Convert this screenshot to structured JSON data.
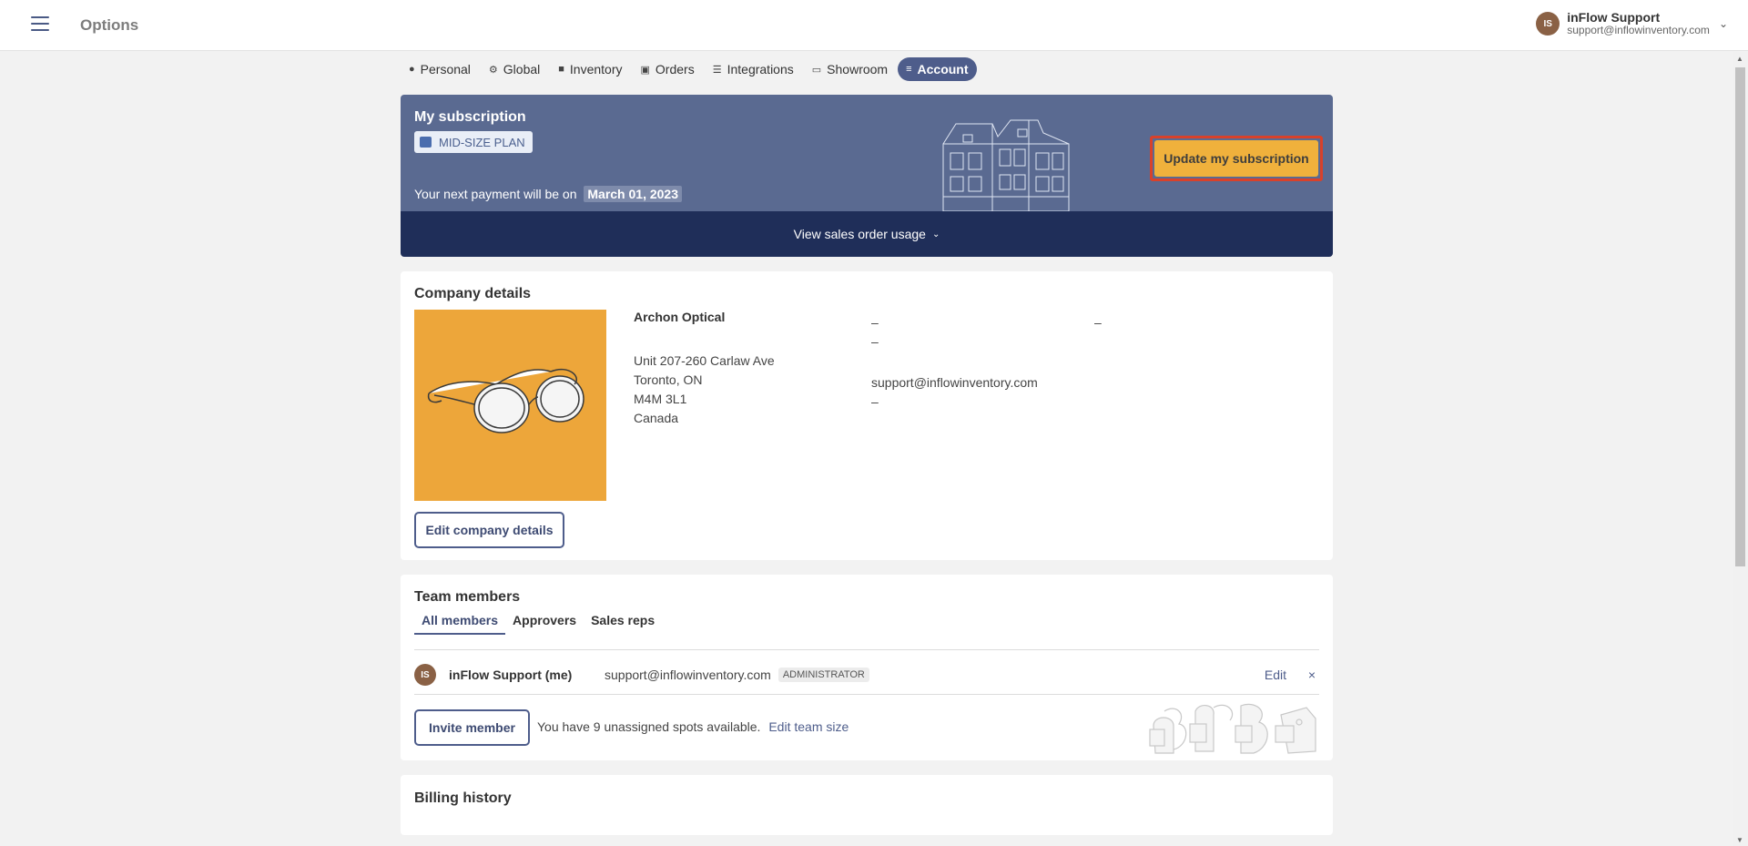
{
  "header": {
    "title": "Options",
    "user_initials": "IS",
    "user_name": "inFlow Support",
    "user_email": "support@inflowinventory.com"
  },
  "tabs": [
    {
      "label": "Personal",
      "icon": "person-icon"
    },
    {
      "label": "Global",
      "icon": "gear-icon"
    },
    {
      "label": "Inventory",
      "icon": "box-icon"
    },
    {
      "label": "Orders",
      "icon": "bag-icon"
    },
    {
      "label": "Integrations",
      "icon": "list-icon"
    },
    {
      "label": "Showroom",
      "icon": "laptop-icon"
    },
    {
      "label": "Account",
      "icon": "sliders-icon",
      "active": true
    }
  ],
  "subscription": {
    "title": "My subscription",
    "plan": "MID-SIZE PLAN",
    "payment_prefix": "Your next payment will be on",
    "payment_date": "March 01, 2023",
    "update_button": "Update my subscription",
    "usage_toggle": "View sales order usage"
  },
  "company": {
    "title": "Company details",
    "name": "Archon Optical",
    "address_line1": "Unit 207-260 Carlaw Ave",
    "address_line2": "Toronto, ON",
    "postal": "M4M 3L1",
    "country": "Canada",
    "dash": "–",
    "email": "support@inflowinventory.com",
    "edit_button": "Edit company details"
  },
  "team": {
    "title": "Team members",
    "tabs": [
      "All members",
      "Approvers",
      "Sales reps"
    ],
    "member": {
      "initials": "IS",
      "name": "inFlow Support (me)",
      "email": "support@inflowinventory.com",
      "role": "ADMINISTRATOR",
      "edit": "Edit",
      "remove": "×"
    },
    "invite_button": "Invite member",
    "spots_text": "You have 9 unassigned spots available.",
    "edit_team_size": "Edit team size"
  },
  "billing": {
    "title": "Billing history"
  },
  "colors": {
    "accent": "#4e5d8b",
    "banner": "#5a6a91",
    "banner_dark": "#1f2e59",
    "update_button": "#f0b13c",
    "highlight_border": "#d9412a",
    "logo_bg": "#eda63a"
  }
}
